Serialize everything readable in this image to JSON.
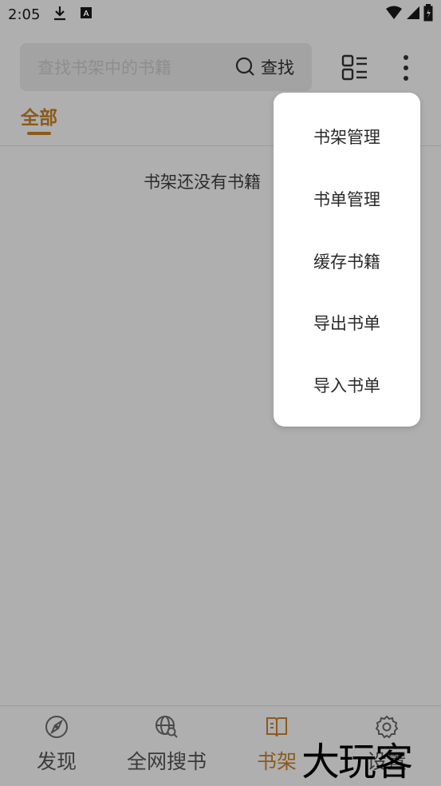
{
  "status_bar": {
    "time": "2:05"
  },
  "search": {
    "placeholder": "查找书架中的书籍",
    "action_label": "查找"
  },
  "tabs": [
    {
      "label": "全部",
      "active": true
    }
  ],
  "empty_message": "书架还没有书籍",
  "menu": {
    "items": [
      {
        "label": "书架管理"
      },
      {
        "label": "书单管理"
      },
      {
        "label": "缓存书籍"
      },
      {
        "label": "导出书单"
      },
      {
        "label": "导入书单"
      }
    ]
  },
  "bottom_nav": {
    "items": [
      {
        "label": "发现",
        "icon": "compass-icon",
        "active": false
      },
      {
        "label": "全网搜书",
        "icon": "globe-search-icon",
        "active": false
      },
      {
        "label": "书架",
        "icon": "book-icon",
        "active": true
      },
      {
        "label": "设置",
        "icon": "gear-icon",
        "active": false
      }
    ]
  },
  "watermark": "大玩客",
  "colors": {
    "accent": "#8a5a1e",
    "background": "#afafaf",
    "menu_bg": "#ffffff"
  }
}
